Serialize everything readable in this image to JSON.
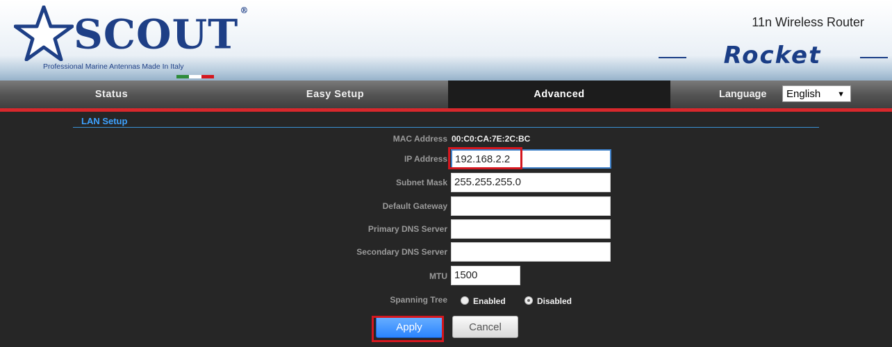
{
  "header": {
    "brand_name": "SCOUT",
    "registered_mark": "®",
    "tagline": "Professional Marine Antennas Made In Italy",
    "product_type": "11n Wireless Router",
    "product_name": "Rocket",
    "flag_colors": [
      "#2e8b3a",
      "#ffffff",
      "#d4171f"
    ]
  },
  "nav": {
    "tabs": [
      {
        "label": "Status"
      },
      {
        "label": "Easy Setup"
      },
      {
        "label": "Advanced",
        "active": true
      }
    ],
    "language_label": "Language",
    "language_value": "English"
  },
  "section": {
    "title": "LAN Setup"
  },
  "fields": {
    "mac": {
      "label": "MAC Address",
      "value": "00:C0:CA:7E:2C:BC"
    },
    "ip": {
      "label": "IP Address",
      "value": "192.168.2.2"
    },
    "subnet": {
      "label": "Subnet Mask",
      "value": "255.255.255.0"
    },
    "gateway": {
      "label": "Default Gateway",
      "value": ""
    },
    "dns1": {
      "label": "Primary DNS Server",
      "value": ""
    },
    "dns2": {
      "label": "Secondary DNS Server",
      "value": ""
    },
    "mtu": {
      "label": "MTU",
      "value": "1500"
    },
    "stp": {
      "label": "Spanning Tree",
      "options": [
        "Enabled",
        "Disabled"
      ],
      "selected": "Disabled"
    }
  },
  "buttons": {
    "apply": "Apply",
    "cancel": "Cancel"
  },
  "colors": {
    "accent_red": "#d4171f",
    "section_blue": "#3da2ff",
    "background": "#262626"
  }
}
